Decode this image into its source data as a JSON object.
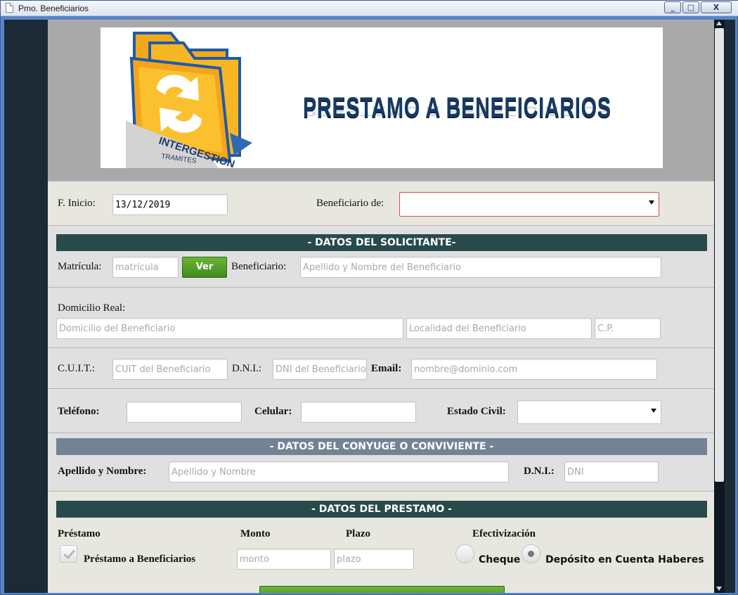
{
  "window": {
    "title": "Pmo. Beneficiarios",
    "minimize": "_",
    "maximize": "□",
    "close": "X"
  },
  "banner": {
    "title": "PRESTAMO A BENEFICIARIOS",
    "logo_text_top": "INTERGESTION",
    "logo_text_bottom": "TRAMITES"
  },
  "start": {
    "label": "F. Inicio:",
    "value": "13/12/2019",
    "beneficiario_label": "Beneficiario de:",
    "beneficiario_value": ""
  },
  "solicitante": {
    "header": "- DATOS DEL SOLICITANTE-",
    "matricula_label": "Matrícula:",
    "matricula_placeholder": "matrícula",
    "ver_button": "Ver",
    "beneficiario_label": "Beneficiario:",
    "beneficiario_placeholder": "Apellido y Nombre del Beneficiario"
  },
  "domicilio": {
    "label": "Domicilio Real:",
    "domicilio_placeholder": "Domicilio del Beneficiario",
    "localidad_placeholder": "Localidad del Beneficiario",
    "cp_placeholder": "C.P."
  },
  "ids": {
    "cuit_label": "C.U.I.T.:",
    "cuit_placeholder": "CUIT del Beneficiario",
    "dni_label": "D.N.I.:",
    "dni_placeholder": "DNI del Beneficiario",
    "email_label": "Email:",
    "email_placeholder": "nombre@dominio.com"
  },
  "contacto": {
    "telefono_label": "Teléfono:",
    "celular_label": "Celular:",
    "estado_civil_label": "Estado Civil:",
    "estado_civil_value": ""
  },
  "conyuge": {
    "header": "- DATOS DEL CONYUGE O CONVIVIENTE -",
    "nombre_label": "Apellido y Nombre:",
    "nombre_placeholder": "Apellido y Nombre",
    "dni_label": "D.N.I.:",
    "dni_placeholder": "DNI"
  },
  "prestamo": {
    "header": "- DATOS DEL PRESTAMO -",
    "prestamo_label": "Préstamo",
    "monto_label": "Monto",
    "plazo_label": "Plazo",
    "efectivizacion_label": "Efectivización",
    "tipo_label": "Préstamo a Beneficiarios",
    "monto_placeholder": "monto",
    "plazo_placeholder": "plazo",
    "cheque_label": "Cheque",
    "deposito_label": "Depósito en Cuenta Haberes",
    "deposito_selected": true
  },
  "colors": {
    "header_dark": "#294a4b",
    "header_slate": "#728396",
    "accent_green": "#4f9d27"
  }
}
